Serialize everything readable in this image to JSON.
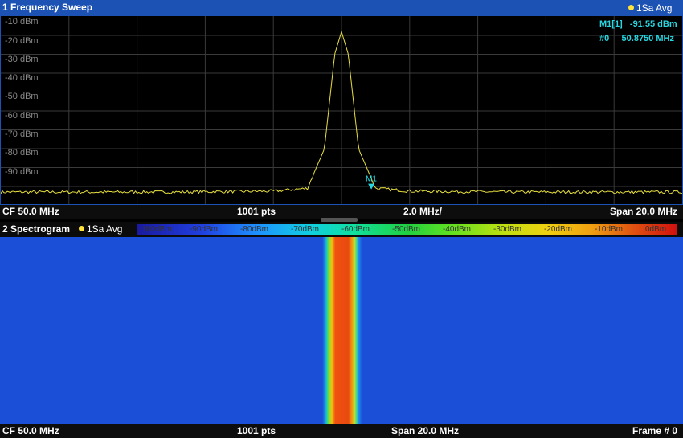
{
  "sweep": {
    "title": "1 Frequency Sweep",
    "avg": "1Sa Avg",
    "y_labels": [
      "-10 dBm",
      "-20 dBm",
      "-30 dBm",
      "-40 dBm",
      "-50 dBm",
      "-60 dBm",
      "-70 dBm",
      "-80 dBm",
      "-90 dBm"
    ],
    "marker_line1_label": "M1[1]",
    "marker_line1_value": "-91.55 dBm",
    "marker_line2_label": "#0",
    "marker_line2_value": "50.8750 MHz",
    "marker_tag": "M1",
    "footer": {
      "cf": "CF 50.0 MHz",
      "pts": "1001 pts",
      "div": "2.0 MHz/",
      "span": "Span 20.0 MHz"
    }
  },
  "spectrogram": {
    "title": "2 Spectrogram",
    "avg": "1Sa Avg",
    "colorbar_labels": [
      "-100dBm",
      "-90dBm",
      "-80dBm",
      "-70dBm",
      "-60dBm",
      "-50dBm",
      "-40dBm",
      "-30dBm",
      "-20dBm",
      "-10dBm",
      "0dBm"
    ],
    "footer": {
      "cf": "CF 50.0 MHz",
      "pts": "1001 pts",
      "span": "Span 20.0 MHz",
      "frame": "Frame # 0"
    }
  },
  "chart_data": {
    "type": "line",
    "x_range_mhz": [
      40,
      60
    ],
    "ylim": [
      -100,
      0
    ],
    "grid": true,
    "series": [
      {
        "x": [
          40,
          45,
          48,
          49,
          49.5,
          49.8,
          50,
          50.2,
          50.5,
          51,
          52,
          55,
          60
        ],
        "values": [
          -93,
          -93,
          -92.5,
          -91,
          -70,
          -20,
          -8,
          -20,
          -70,
          -91,
          -92.5,
          -93,
          -93
        ]
      }
    ],
    "markers": [
      {
        "x": 50.875,
        "y": -91.55
      }
    ],
    "colors": {
      "trace": "#e8e040",
      "marker": "#27d6e0"
    }
  }
}
